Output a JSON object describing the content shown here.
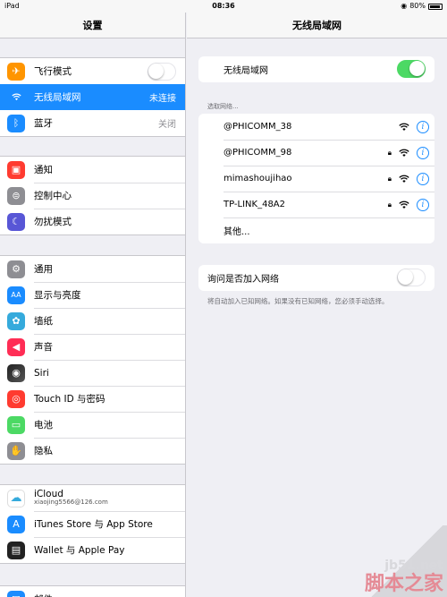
{
  "statusbar": {
    "device": "iPad",
    "time": "08:36",
    "battery": "80%"
  },
  "sidebar": {
    "title": "设置",
    "groups": [
      {
        "items": [
          {
            "label": "飞行模式",
            "icon": "airplane-icon",
            "color": "#ff9500",
            "glyph": "✈",
            "toggle": "off"
          },
          {
            "label": "无线局域网",
            "icon": "wifi-icon",
            "color": "#1a8cff",
            "glyph": "≋",
            "value": "未连接",
            "selected": true
          },
          {
            "label": "蓝牙",
            "icon": "bluetooth-icon",
            "color": "#1a8cff",
            "glyph": "ᛒ",
            "value": "关闭"
          }
        ]
      },
      {
        "items": [
          {
            "label": "通知",
            "icon": "notifications-icon",
            "color": "#ff3b30",
            "glyph": "▣"
          },
          {
            "label": "控制中心",
            "icon": "control-center-icon",
            "color": "#8e8e93",
            "glyph": "⊜"
          },
          {
            "label": "勿扰模式",
            "icon": "do-not-disturb-icon",
            "color": "#5856d6",
            "glyph": "☾"
          }
        ]
      },
      {
        "items": [
          {
            "label": "通用",
            "icon": "general-icon",
            "color": "#8e8e93",
            "glyph": "⚙"
          },
          {
            "label": "显示与亮度",
            "icon": "display-icon",
            "color": "#1a8cff",
            "glyph": "AA"
          },
          {
            "label": "墙纸",
            "icon": "wallpaper-icon",
            "color": "#35aadc",
            "glyph": "✿"
          },
          {
            "label": "声音",
            "icon": "sounds-icon",
            "color": "#ff2d55",
            "glyph": "◀"
          },
          {
            "label": "Siri",
            "icon": "siri-icon",
            "color": "#222222",
            "glyph": "◉"
          },
          {
            "label": "Touch ID 与密码",
            "icon": "touch-id-icon",
            "color": "#ff3b30",
            "glyph": "◎"
          },
          {
            "label": "电池",
            "icon": "battery-icon",
            "color": "#4cd964",
            "glyph": "▭"
          },
          {
            "label": "隐私",
            "icon": "privacy-icon",
            "color": "#8e8e93",
            "glyph": "✋"
          }
        ]
      },
      {
        "items": [
          {
            "label": "iCloud",
            "sub": "xiaojing5566@126.com",
            "icon": "icloud-icon",
            "color": "#ffffff",
            "glyph": "☁"
          },
          {
            "label": "iTunes Store 与 App Store",
            "icon": "app-store-icon",
            "color": "#1a8cff",
            "glyph": "A"
          },
          {
            "label": "Wallet 与 Apple Pay",
            "icon": "wallet-icon",
            "color": "#222222",
            "glyph": "▤"
          }
        ]
      },
      {
        "items": [
          {
            "label": "邮件",
            "icon": "mail-icon",
            "color": "#1a8cff",
            "glyph": "✉"
          }
        ]
      }
    ]
  },
  "wifi": {
    "title": "无线局域网",
    "toggle_label": "无线局域网",
    "toggle": "on",
    "choose_label": "选取网络...",
    "networks": [
      {
        "name": "@PHICOMM_38",
        "locked": false
      },
      {
        "name": "@PHICOMM_98",
        "locked": true
      },
      {
        "name": "mimashoujihao",
        "locked": true
      },
      {
        "name": "TP-LINK_48A2",
        "locked": true
      }
    ],
    "other_label": "其他...",
    "ask_label": "询问是否加入网络",
    "ask_toggle": "off",
    "ask_note": "将自动加入已知网络。如果没有已知网络，您必须手动选择。"
  },
  "watermark": {
    "line1": "jb51.net",
    "line2": "脚本之家"
  }
}
